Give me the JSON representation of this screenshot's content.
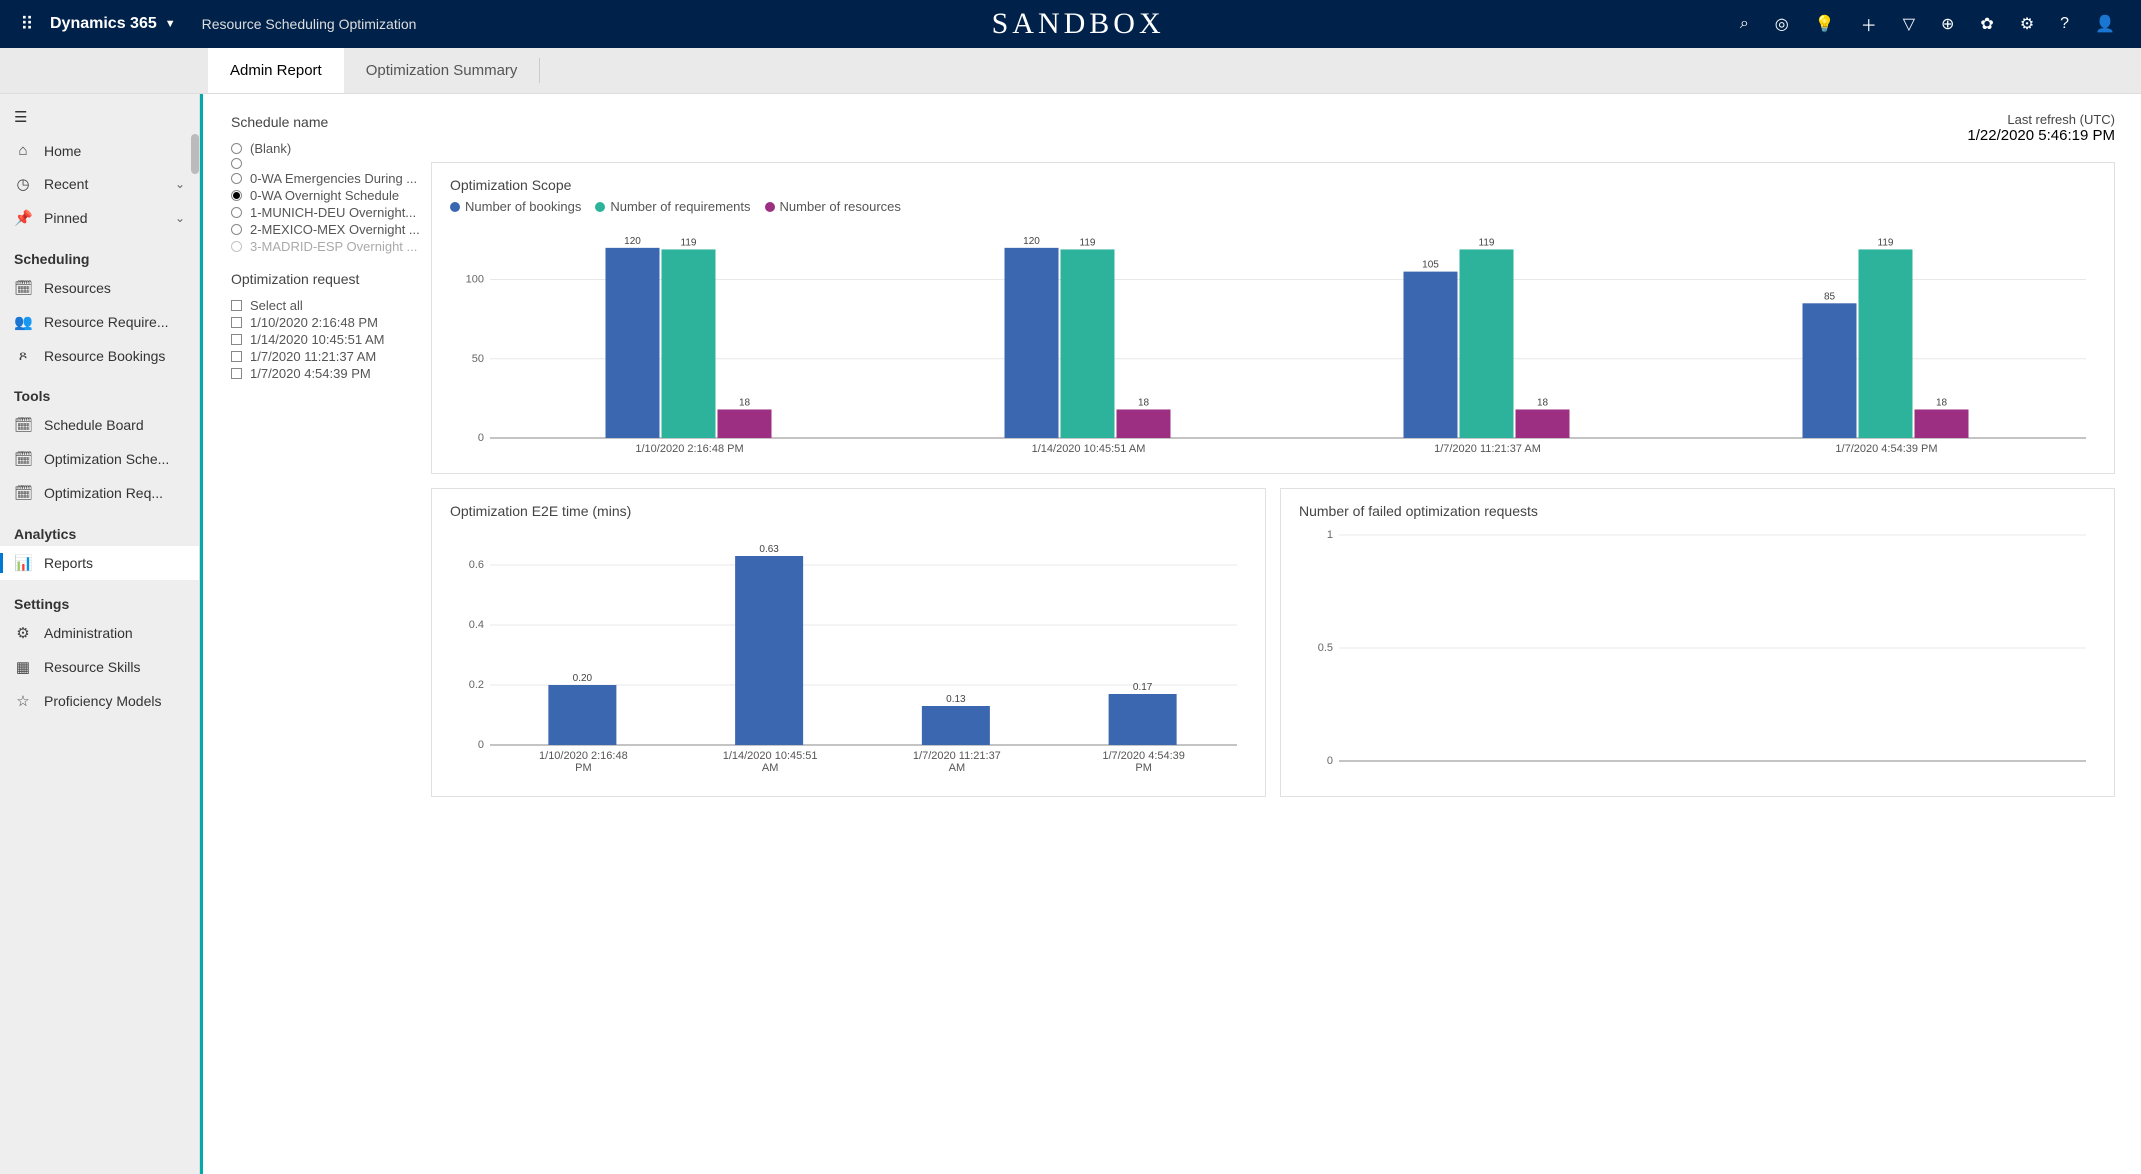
{
  "topbar": {
    "brand": "Dynamics 365",
    "apptitle": "Resource Scheduling Optimization",
    "sandbox": "SANDBOX"
  },
  "tabs": {
    "admin": "Admin Report",
    "summary": "Optimization Summary"
  },
  "sidebar": {
    "home": "Home",
    "recent": "Recent",
    "pinned": "Pinned",
    "sec_scheduling": "Scheduling",
    "resources": "Resources",
    "res_require": "Resource Require...",
    "res_bookings": "Resource Bookings",
    "sec_tools": "Tools",
    "schedule_board": "Schedule Board",
    "opt_sche": "Optimization Sche...",
    "opt_req": "Optimization Req...",
    "sec_analytics": "Analytics",
    "reports": "Reports",
    "sec_settings": "Settings",
    "administration": "Administration",
    "resource_skills": "Resource Skills",
    "proficiency": "Proficiency Models"
  },
  "filters": {
    "schedule_title": "Schedule name",
    "s0": "(Blank)",
    "s1": "",
    "s2": "0-WA Emergencies During ...",
    "s3": "0-WA Overnight Schedule",
    "s4": "1-MUNICH-DEU Overnight...",
    "s5": "2-MEXICO-MEX Overnight ...",
    "s6": "3-MADRID-ESP Overnight ...",
    "opt_title": "Optimization request",
    "o0": "Select all",
    "o1": "1/10/2020 2:16:48 PM",
    "o2": "1/14/2020 10:45:51 AM",
    "o3": "1/7/2020 11:21:37 AM",
    "o4": "1/7/2020 4:54:39 PM"
  },
  "refresh": {
    "label": "Last refresh (UTC)",
    "time": "1/22/2020 5:46:19 PM"
  },
  "charts": {
    "scope": {
      "title": "Optimization Scope",
      "leg1": "Number of bookings",
      "leg2": "Number of requirements",
      "leg3": "Number of resources"
    },
    "e2e": {
      "title": "Optimization E2E time (mins)"
    },
    "failed": {
      "title": "Number of failed optimization requests"
    }
  },
  "chart_data": [
    {
      "id": "scope",
      "type": "bar",
      "categories": [
        "1/10/2020 2:16:48 PM",
        "1/14/2020 10:45:51 AM",
        "1/7/2020 11:21:37 AM",
        "1/7/2020 4:54:39 PM"
      ],
      "series": [
        {
          "name": "Number of bookings",
          "color": "#3b66b0",
          "values": [
            120,
            120,
            105,
            85
          ]
        },
        {
          "name": "Number of requirements",
          "color": "#2db39b",
          "values": [
            119,
            119,
            119,
            119
          ]
        },
        {
          "name": "Number of resources",
          "color": "#9c2f82",
          "values": [
            18,
            18,
            18,
            18
          ]
        }
      ],
      "yticks": [
        0,
        50,
        100
      ],
      "ylim": [
        0,
        130
      ]
    },
    {
      "id": "e2e",
      "type": "bar",
      "categories": [
        "1/10/2020 2:16:48 PM",
        "1/14/2020 10:45:51 AM",
        "1/7/2020 11:21:37 AM",
        "1/7/2020 4:54:39 PM"
      ],
      "series": [
        {
          "name": "E2E",
          "color": "#3b66b0",
          "values": [
            0.2,
            0.63,
            0.13,
            0.17
          ]
        }
      ],
      "yticks": [
        0.0,
        0.2,
        0.4,
        0.6
      ],
      "ylim": [
        0,
        0.7
      ]
    },
    {
      "id": "failed",
      "type": "bar",
      "categories": [],
      "series": [],
      "yticks": [
        0.0,
        0.5,
        1.0
      ],
      "ylim": [
        0,
        1.0
      ]
    }
  ]
}
